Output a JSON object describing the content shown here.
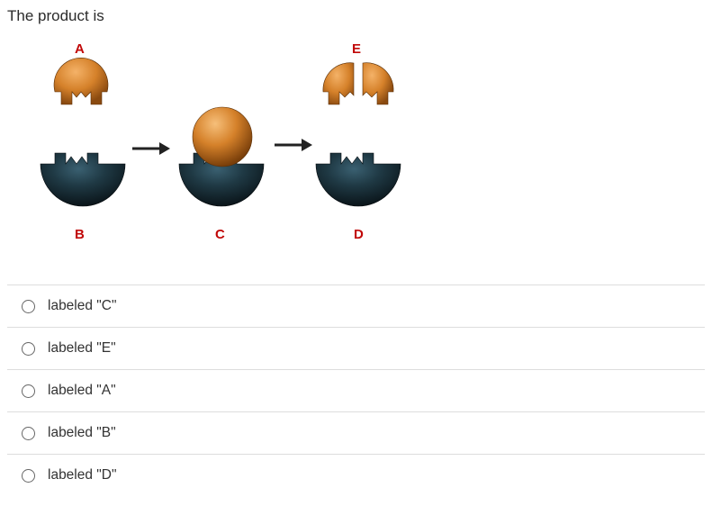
{
  "question": "The product is",
  "diagram": {
    "labels": {
      "A": "A",
      "B": "B",
      "C": "C",
      "D": "D",
      "E": "E"
    }
  },
  "options": [
    {
      "text": "labeled \"C\""
    },
    {
      "text": "labeled \"E\""
    },
    {
      "text": "labeled \"A\""
    },
    {
      "text": "labeled \"B\""
    },
    {
      "text": "labeled \"D\""
    }
  ]
}
